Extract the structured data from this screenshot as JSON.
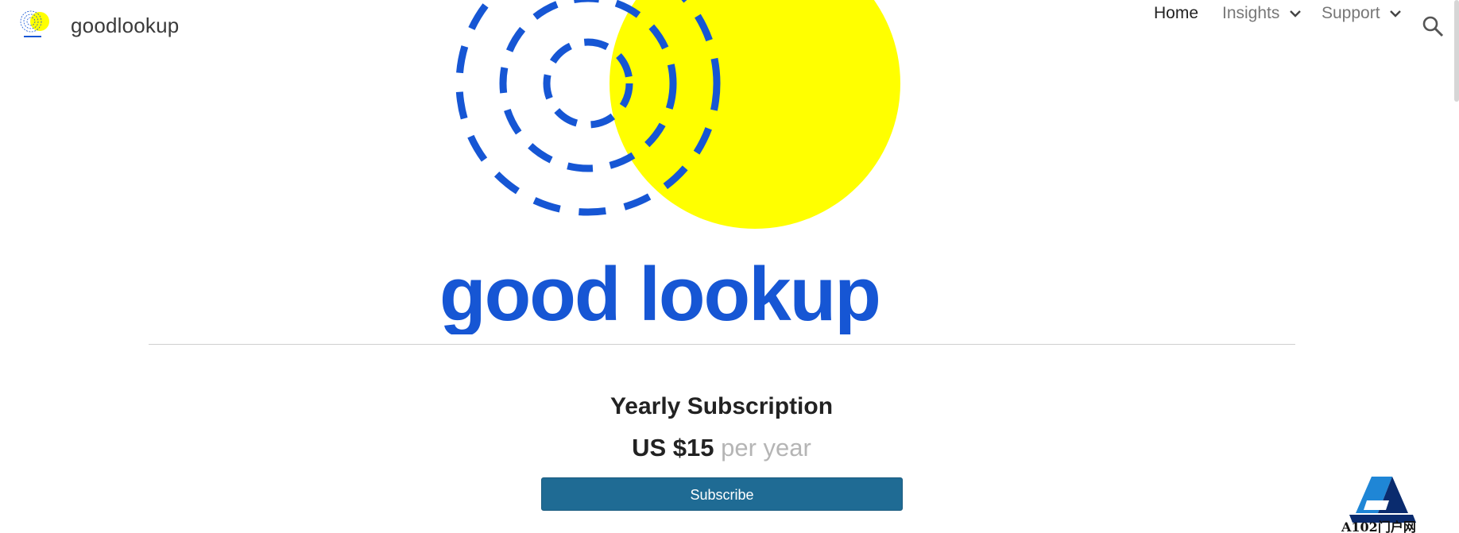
{
  "header": {
    "site_name": "goodlookup",
    "logo_icon": "goodlookup-logo-icon"
  },
  "nav": {
    "items": [
      {
        "label": "Home",
        "active": true,
        "has_menu": false
      },
      {
        "label": "Insights",
        "active": false,
        "has_menu": true
      },
      {
        "label": "Support",
        "active": false,
        "has_menu": true
      }
    ],
    "search_icon": "search-icon"
  },
  "hero": {
    "wordmark": "good lookup"
  },
  "subscription": {
    "title": "Yearly Subscription",
    "price": "US $15",
    "period": "per year",
    "button_label": "Subscribe"
  },
  "watermark": {
    "text": "A102门户网"
  },
  "colors": {
    "brand_blue": "#1656d4",
    "brand_yellow": "#ffff00",
    "button": "#1f6b94"
  }
}
